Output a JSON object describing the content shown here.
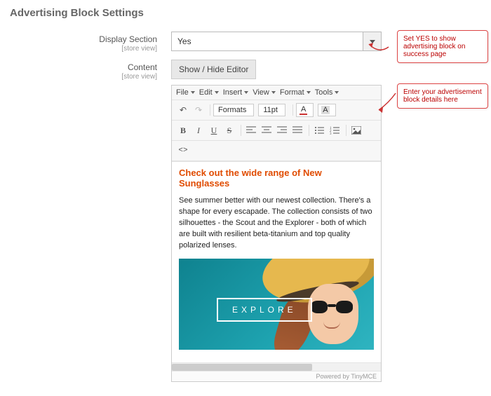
{
  "section_title": "Advertising Block Settings",
  "fields": {
    "display_section": {
      "label": "Display Section",
      "scope": "[store view]",
      "value": "Yes"
    },
    "content": {
      "label": "Content",
      "scope": "[store view]",
      "toggle_button": "Show / Hide Editor"
    }
  },
  "editor": {
    "menus": {
      "file": "File",
      "edit": "Edit",
      "insert": "Insert",
      "view": "View",
      "format": "Format",
      "tools": "Tools"
    },
    "toolbar": {
      "formats_label": "Formats",
      "fontsize_label": "11pt",
      "fontcolor_label": "A",
      "bgcolor_label": "A"
    },
    "content": {
      "heading": "Check out the wide range of New Sunglasses",
      "paragraph": "See summer better with our newest collection. There's a shape for every escapade. The collection consists of two silhouettes - the Scout and the Explorer - both of which are built with resilient beta-titanium and top quality polarized lenses.",
      "cta_label": "EXPLORE"
    },
    "status": {
      "powered_by": "Powered by TinyMCE"
    }
  },
  "callouts": {
    "display_section_tip": "Set YES to show advertising block on success page",
    "content_tip": "Enter your advertisement block details here"
  }
}
